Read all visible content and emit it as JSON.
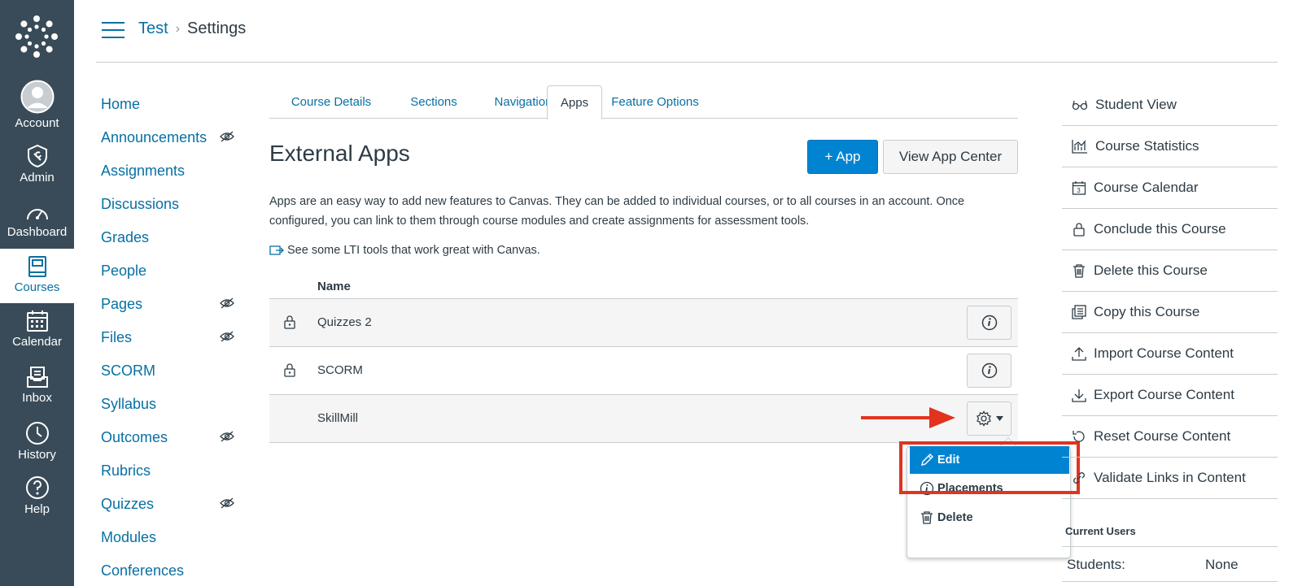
{
  "global_nav": {
    "items": [
      {
        "label": "Account",
        "icon": "account-icon"
      },
      {
        "label": "Admin",
        "icon": "admin-icon"
      },
      {
        "label": "Dashboard",
        "icon": "dashboard-icon"
      },
      {
        "label": "Courses",
        "icon": "courses-icon",
        "active": true
      },
      {
        "label": "Calendar",
        "icon": "calendar-icon"
      },
      {
        "label": "Inbox",
        "icon": "inbox-icon"
      },
      {
        "label": "History",
        "icon": "history-icon"
      },
      {
        "label": "Help",
        "icon": "help-icon"
      }
    ]
  },
  "breadcrumb": {
    "course": "Test",
    "current": "Settings"
  },
  "course_nav": {
    "items": [
      {
        "label": "Home",
        "hidden": false
      },
      {
        "label": "Announcements",
        "hidden": true
      },
      {
        "label": "Assignments",
        "hidden": false
      },
      {
        "label": "Discussions",
        "hidden": false
      },
      {
        "label": "Grades",
        "hidden": false
      },
      {
        "label": "People",
        "hidden": false
      },
      {
        "label": "Pages",
        "hidden": true
      },
      {
        "label": "Files",
        "hidden": true
      },
      {
        "label": "SCORM",
        "hidden": false
      },
      {
        "label": "Syllabus",
        "hidden": false
      },
      {
        "label": "Outcomes",
        "hidden": true
      },
      {
        "label": "Rubrics",
        "hidden": false
      },
      {
        "label": "Quizzes",
        "hidden": true
      },
      {
        "label": "Modules",
        "hidden": false
      },
      {
        "label": "Conferences",
        "hidden": false
      }
    ]
  },
  "tabs": [
    {
      "label": "Course Details"
    },
    {
      "label": "Sections"
    },
    {
      "label": "Navigation"
    },
    {
      "label": "Apps",
      "active": true
    },
    {
      "label": "Feature Options"
    }
  ],
  "external_apps": {
    "title": "External Apps",
    "add_button": "+ App",
    "view_center_button": "View App Center",
    "description": "Apps are an easy way to add new features to Canvas. They can be added to individual courses, or to all courses in an account. Once configured, you can link to them through course modules and create assignments for assessment tools.",
    "lti_link": "See some LTI tools that work great with Canvas.",
    "column_name": "Name",
    "rows": [
      {
        "name": "Quizzes 2",
        "locked": true
      },
      {
        "name": "SCORM",
        "locked": true
      },
      {
        "name": "SkillMill",
        "locked": false
      }
    ]
  },
  "dropdown": {
    "items": [
      {
        "label": "Edit",
        "icon": "pencil-icon",
        "active": true
      },
      {
        "label": "Placements",
        "icon": "info-icon"
      },
      {
        "label": "Delete",
        "icon": "trash-icon"
      }
    ]
  },
  "right_sidebar": {
    "items": [
      {
        "label": "Student View",
        "icon": "glasses-icon"
      },
      {
        "label": "Course Statistics",
        "icon": "stats-icon"
      },
      {
        "label": "Course Calendar",
        "icon": "calendar-icon"
      },
      {
        "label": "Conclude this Course",
        "icon": "lock-icon"
      },
      {
        "label": "Delete this Course",
        "icon": "trash-icon"
      },
      {
        "label": "Copy this Course",
        "icon": "copy-icon"
      },
      {
        "label": "Import Course Content",
        "icon": "upload-icon"
      },
      {
        "label": "Export Course Content",
        "icon": "download-icon"
      },
      {
        "label": "Reset Course Content",
        "icon": "reset-icon"
      },
      {
        "label": "Validate Links in Content",
        "icon": "link-icon"
      }
    ],
    "current_users_title": "Current Users",
    "students_label": "Students:",
    "students_value": "None"
  },
  "colors": {
    "nav_bg": "#394b58",
    "link": "#0770a3",
    "primary": "#0084d1",
    "annotation": "#e2331f"
  }
}
